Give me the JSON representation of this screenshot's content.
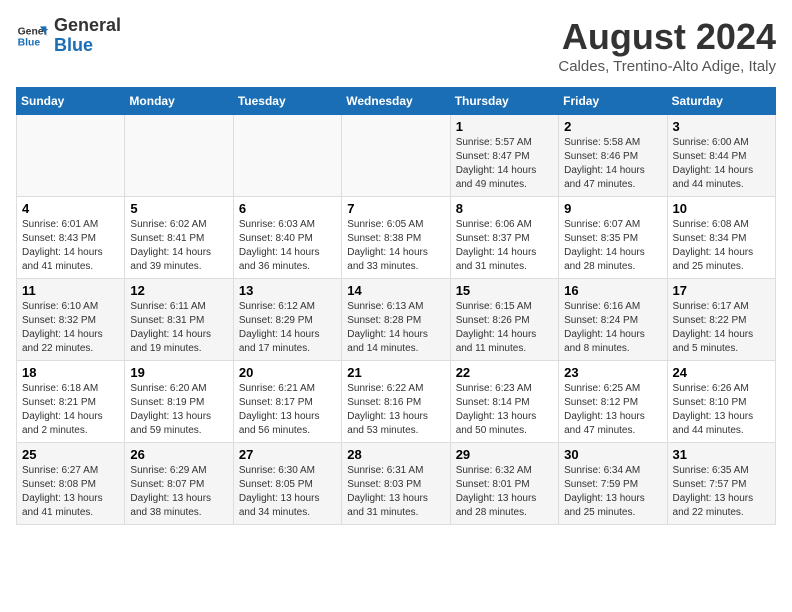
{
  "logo": {
    "line1": "General",
    "line2": "Blue"
  },
  "title": "August 2024",
  "subtitle": "Caldes, Trentino-Alto Adige, Italy",
  "days_of_week": [
    "Sunday",
    "Monday",
    "Tuesday",
    "Wednesday",
    "Thursday",
    "Friday",
    "Saturday"
  ],
  "weeks": [
    [
      {
        "day": "",
        "info": ""
      },
      {
        "day": "",
        "info": ""
      },
      {
        "day": "",
        "info": ""
      },
      {
        "day": "",
        "info": ""
      },
      {
        "day": "1",
        "info": "Sunrise: 5:57 AM\nSunset: 8:47 PM\nDaylight: 14 hours\nand 49 minutes."
      },
      {
        "day": "2",
        "info": "Sunrise: 5:58 AM\nSunset: 8:46 PM\nDaylight: 14 hours\nand 47 minutes."
      },
      {
        "day": "3",
        "info": "Sunrise: 6:00 AM\nSunset: 8:44 PM\nDaylight: 14 hours\nand 44 minutes."
      }
    ],
    [
      {
        "day": "4",
        "info": "Sunrise: 6:01 AM\nSunset: 8:43 PM\nDaylight: 14 hours\nand 41 minutes."
      },
      {
        "day": "5",
        "info": "Sunrise: 6:02 AM\nSunset: 8:41 PM\nDaylight: 14 hours\nand 39 minutes."
      },
      {
        "day": "6",
        "info": "Sunrise: 6:03 AM\nSunset: 8:40 PM\nDaylight: 14 hours\nand 36 minutes."
      },
      {
        "day": "7",
        "info": "Sunrise: 6:05 AM\nSunset: 8:38 PM\nDaylight: 14 hours\nand 33 minutes."
      },
      {
        "day": "8",
        "info": "Sunrise: 6:06 AM\nSunset: 8:37 PM\nDaylight: 14 hours\nand 31 minutes."
      },
      {
        "day": "9",
        "info": "Sunrise: 6:07 AM\nSunset: 8:35 PM\nDaylight: 14 hours\nand 28 minutes."
      },
      {
        "day": "10",
        "info": "Sunrise: 6:08 AM\nSunset: 8:34 PM\nDaylight: 14 hours\nand 25 minutes."
      }
    ],
    [
      {
        "day": "11",
        "info": "Sunrise: 6:10 AM\nSunset: 8:32 PM\nDaylight: 14 hours\nand 22 minutes."
      },
      {
        "day": "12",
        "info": "Sunrise: 6:11 AM\nSunset: 8:31 PM\nDaylight: 14 hours\nand 19 minutes."
      },
      {
        "day": "13",
        "info": "Sunrise: 6:12 AM\nSunset: 8:29 PM\nDaylight: 14 hours\nand 17 minutes."
      },
      {
        "day": "14",
        "info": "Sunrise: 6:13 AM\nSunset: 8:28 PM\nDaylight: 14 hours\nand 14 minutes."
      },
      {
        "day": "15",
        "info": "Sunrise: 6:15 AM\nSunset: 8:26 PM\nDaylight: 14 hours\nand 11 minutes."
      },
      {
        "day": "16",
        "info": "Sunrise: 6:16 AM\nSunset: 8:24 PM\nDaylight: 14 hours\nand 8 minutes."
      },
      {
        "day": "17",
        "info": "Sunrise: 6:17 AM\nSunset: 8:22 PM\nDaylight: 14 hours\nand 5 minutes."
      }
    ],
    [
      {
        "day": "18",
        "info": "Sunrise: 6:18 AM\nSunset: 8:21 PM\nDaylight: 14 hours\nand 2 minutes."
      },
      {
        "day": "19",
        "info": "Sunrise: 6:20 AM\nSunset: 8:19 PM\nDaylight: 13 hours\nand 59 minutes."
      },
      {
        "day": "20",
        "info": "Sunrise: 6:21 AM\nSunset: 8:17 PM\nDaylight: 13 hours\nand 56 minutes."
      },
      {
        "day": "21",
        "info": "Sunrise: 6:22 AM\nSunset: 8:16 PM\nDaylight: 13 hours\nand 53 minutes."
      },
      {
        "day": "22",
        "info": "Sunrise: 6:23 AM\nSunset: 8:14 PM\nDaylight: 13 hours\nand 50 minutes."
      },
      {
        "day": "23",
        "info": "Sunrise: 6:25 AM\nSunset: 8:12 PM\nDaylight: 13 hours\nand 47 minutes."
      },
      {
        "day": "24",
        "info": "Sunrise: 6:26 AM\nSunset: 8:10 PM\nDaylight: 13 hours\nand 44 minutes."
      }
    ],
    [
      {
        "day": "25",
        "info": "Sunrise: 6:27 AM\nSunset: 8:08 PM\nDaylight: 13 hours\nand 41 minutes."
      },
      {
        "day": "26",
        "info": "Sunrise: 6:29 AM\nSunset: 8:07 PM\nDaylight: 13 hours\nand 38 minutes."
      },
      {
        "day": "27",
        "info": "Sunrise: 6:30 AM\nSunset: 8:05 PM\nDaylight: 13 hours\nand 34 minutes."
      },
      {
        "day": "28",
        "info": "Sunrise: 6:31 AM\nSunset: 8:03 PM\nDaylight: 13 hours\nand 31 minutes."
      },
      {
        "day": "29",
        "info": "Sunrise: 6:32 AM\nSunset: 8:01 PM\nDaylight: 13 hours\nand 28 minutes."
      },
      {
        "day": "30",
        "info": "Sunrise: 6:34 AM\nSunset: 7:59 PM\nDaylight: 13 hours\nand 25 minutes."
      },
      {
        "day": "31",
        "info": "Sunrise: 6:35 AM\nSunset: 7:57 PM\nDaylight: 13 hours\nand 22 minutes."
      }
    ]
  ]
}
